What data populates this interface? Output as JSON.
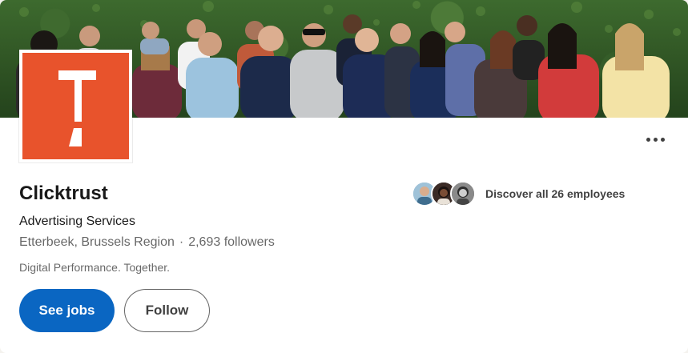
{
  "company": {
    "name": "Clicktrust",
    "industry": "Advertising Services",
    "location": "Etterbeek, Brussels Region",
    "separator": "·",
    "followers": "2,693 followers",
    "tagline": "Digital Performance. Together.",
    "brand_color": "#e8532c"
  },
  "employees": {
    "label": "Discover all 26 employees"
  },
  "actions": {
    "primary_label": "See jobs",
    "secondary_label": "Follow",
    "primary_color": "#0a66c2"
  },
  "icons": {
    "more": "more-horizontal-icon"
  }
}
